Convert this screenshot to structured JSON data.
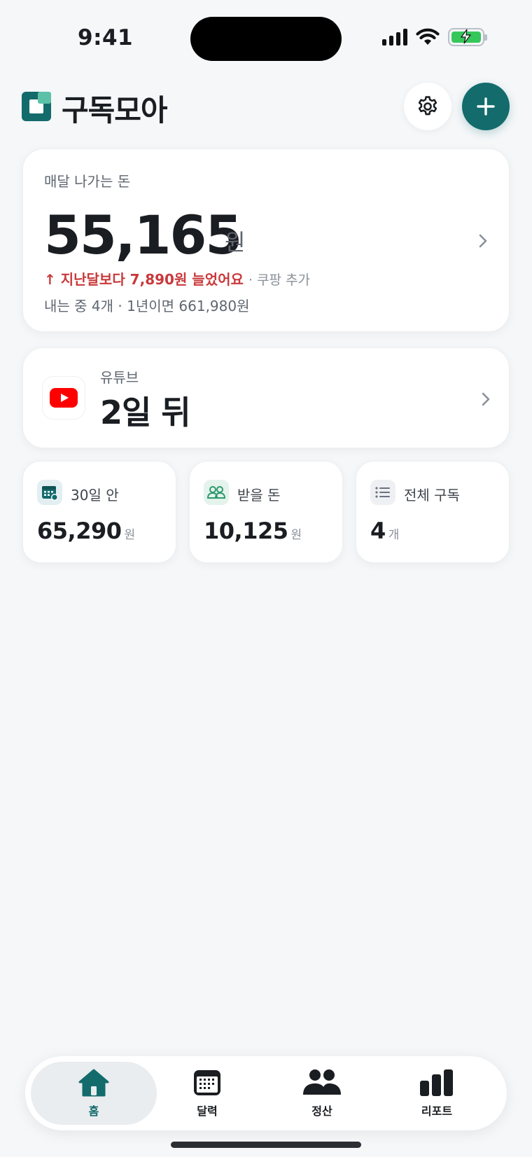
{
  "status": {
    "time": "9:41"
  },
  "header": {
    "title": "구독모아"
  },
  "colors": {
    "accent": "#136b6c",
    "warning": "#c9393b",
    "youtube": "#ff0000"
  },
  "monthly": {
    "label": "매달 나가는 돈",
    "amount": "55,165",
    "unit": "원",
    "change_text": "↑ 지난달보다 7,890원 늘었어요",
    "change_note": "· 쿠팡 추가",
    "summary": "내는 중 4개 · 1년이면 661,980원"
  },
  "next_payment": {
    "service": "유튜브",
    "days": "2일 뒤",
    "icon": "youtube-icon"
  },
  "stats": [
    {
      "label": "30일 안",
      "value": "65,290",
      "unit": "원",
      "icon": "calendar-icon"
    },
    {
      "label": "받을 돈",
      "value": "10,125",
      "unit": "원",
      "icon": "people-icon"
    },
    {
      "label": "전체 구독",
      "value": "4",
      "unit": "개",
      "icon": "list-icon"
    }
  ],
  "tabs": [
    {
      "label": "홈",
      "icon": "home-icon",
      "active": true
    },
    {
      "label": "달력",
      "icon": "calendar-icon"
    },
    {
      "label": "정산",
      "icon": "people-icon"
    },
    {
      "label": "리포트",
      "icon": "bar-chart-icon"
    }
  ]
}
